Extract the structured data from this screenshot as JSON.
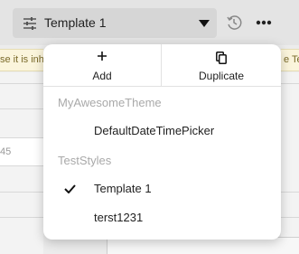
{
  "toolbar": {
    "template_select": {
      "value": "Template 1",
      "icon": "tune-icon",
      "caret": "caret-down-icon"
    },
    "history_icon": "history-icon",
    "more_icon": "more-horizontal-icon"
  },
  "background": {
    "warning_left": "se it is inh",
    "warning_right": "e Ten",
    "left_field_value": "45"
  },
  "menu": {
    "actions": [
      {
        "label": "Add",
        "icon": "plus-icon"
      },
      {
        "label": "Duplicate",
        "icon": "duplicate-icon"
      }
    ],
    "groups": [
      {
        "header": "MyAwesomeTheme",
        "items": [
          {
            "label": "DefaultDateTimePicker",
            "selected": false
          }
        ]
      },
      {
        "header": "TestStyles",
        "items": [
          {
            "label": "Template 1",
            "selected": true
          },
          {
            "label": "terst1231",
            "selected": false
          }
        ]
      }
    ]
  },
  "colors": {
    "toolbar_bg": "#e4e4e4",
    "select_bg": "#d6d6d6",
    "warning_bg": "#fbf5dc",
    "group_header": "#a9a9a9"
  }
}
